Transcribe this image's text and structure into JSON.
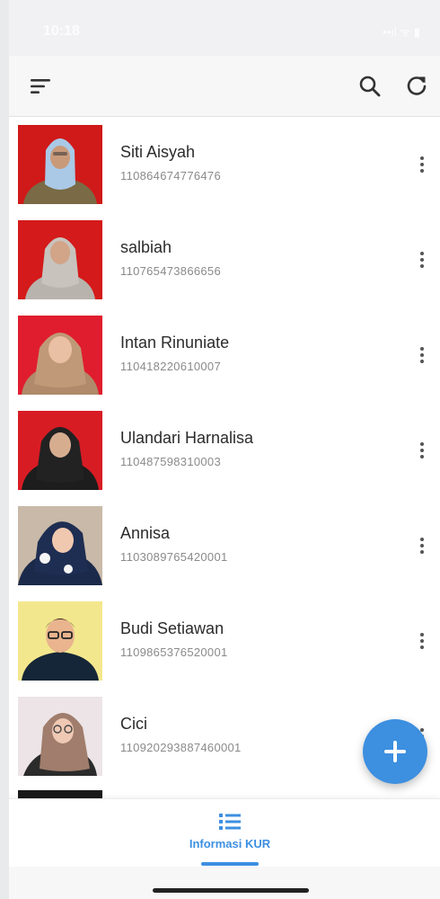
{
  "status_bar": {
    "time": "10:18",
    "icons": "••ıl ᯤ ▮"
  },
  "toolbar": {
    "menu_icon": "filter-list-icon",
    "search_icon": "search-icon",
    "refresh_icon": "refresh-icon"
  },
  "contacts": [
    {
      "name": "Siti Aisyah",
      "id": "110864674776476",
      "avatar_bg": "#d01919"
    },
    {
      "name": "salbiah",
      "id": "110765473866656",
      "avatar_bg": "#d41a1a"
    },
    {
      "name": "Intan Rinuniate",
      "id": "110418220610007",
      "avatar_bg": "#e01d2e"
    },
    {
      "name": "Ulandari Harnalisa",
      "id": "110487598310003",
      "avatar_bg": "#d81c24"
    },
    {
      "name": "Annisa",
      "id": "1103089765420001",
      "avatar_bg": "#c9b9a8"
    },
    {
      "name": "Budi Setiawan",
      "id": "1109865376520001",
      "avatar_bg": "#f3e78e"
    },
    {
      "name": "Cici",
      "id": "110920293887460001",
      "avatar_bg": "#ece4e6"
    }
  ],
  "fab": {
    "icon": "plus-icon"
  },
  "bottom_nav": {
    "label": "Informasi KUR",
    "icon": "list-icon"
  },
  "colors": {
    "accent": "#3d8fe0",
    "text_primary": "#2b2b2b",
    "text_secondary": "#8a8a8a"
  }
}
